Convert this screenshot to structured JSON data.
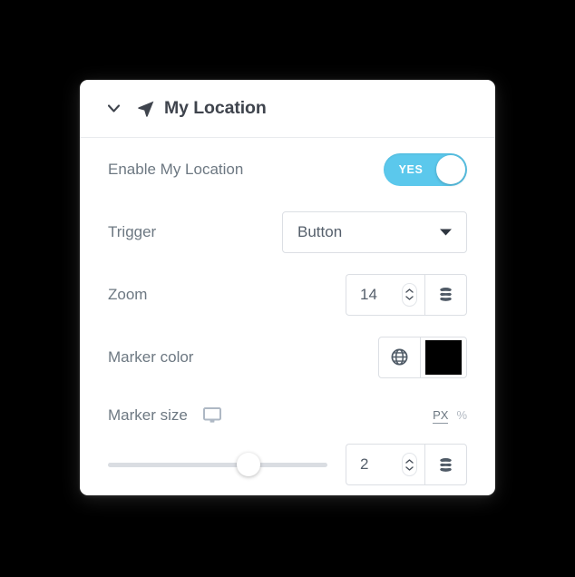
{
  "panel": {
    "header": {
      "title": "My Location",
      "collapse_icon": "chevron-down-icon",
      "location_icon": "navigation-arrow-icon"
    }
  },
  "rows": {
    "enable": {
      "label": "Enable My Location",
      "toggle_value": "YES",
      "toggle_on": true,
      "toggle_color": "#5bc8ec"
    },
    "trigger": {
      "label": "Trigger",
      "selected": "Button",
      "options": [
        "Button"
      ]
    },
    "zoom": {
      "label": "Zoom",
      "value": "14",
      "dynamic_icon": "database-stack-icon"
    },
    "marker_color": {
      "label": "Marker color",
      "globe_icon": "globe-icon",
      "swatch_color": "#000000"
    },
    "marker_size": {
      "label": "Marker size",
      "device_icon": "desktop-monitor-icon",
      "units": [
        {
          "label": "PX",
          "active": true
        },
        {
          "label": "%",
          "active": false
        }
      ],
      "value": "2",
      "slider_percent": 64,
      "dynamic_icon": "database-stack-icon"
    }
  }
}
